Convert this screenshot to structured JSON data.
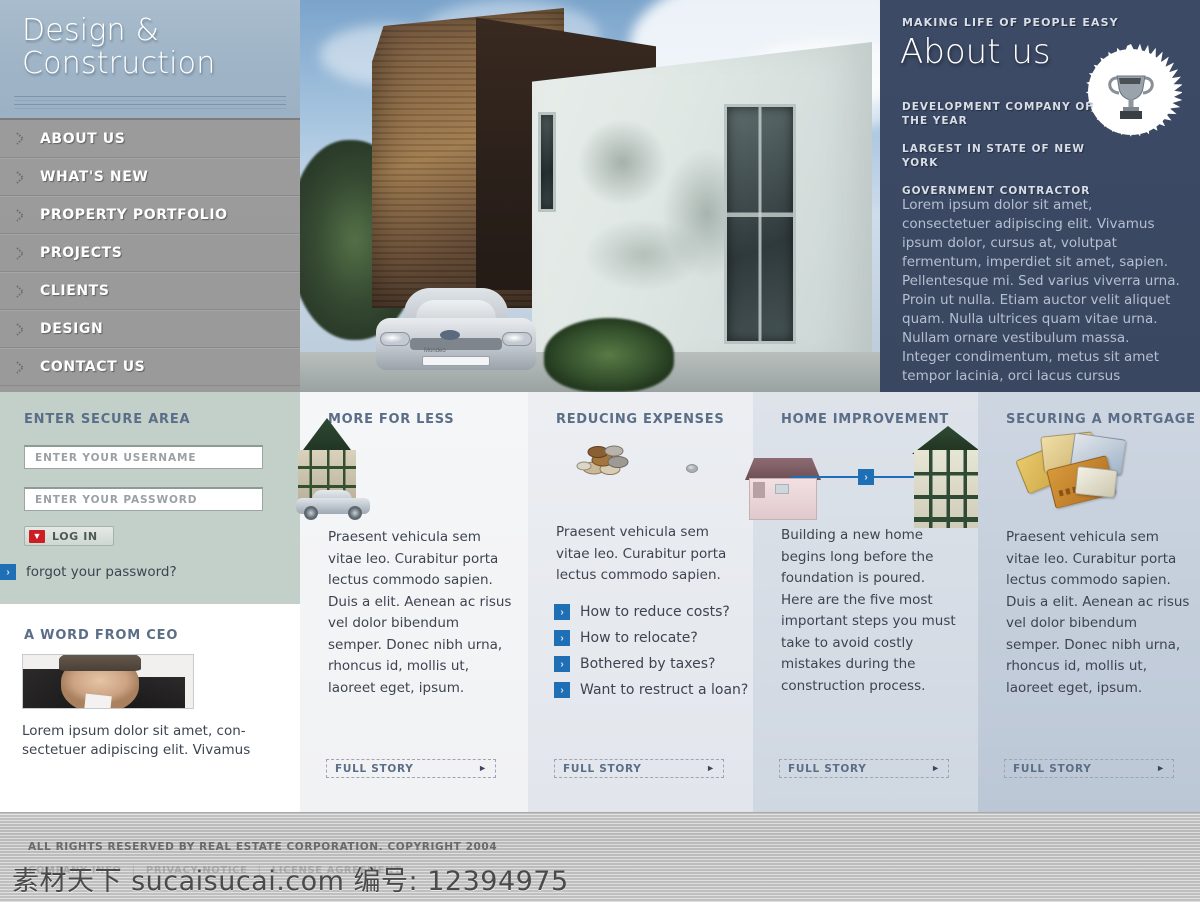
{
  "brand": {
    "line1": "Design &",
    "line2": "Construction"
  },
  "nav": {
    "items": [
      {
        "label": "ABOUT US"
      },
      {
        "label": "WHAT'S NEW"
      },
      {
        "label": "PROPERTY PORTFOLIO"
      },
      {
        "label": "PROJECTS"
      },
      {
        "label": "CLIENTS"
      },
      {
        "label": "DESIGN"
      },
      {
        "label": "CONTACT US"
      }
    ]
  },
  "about": {
    "kicker": "MAKING LIFE OF PEOPLE EASY",
    "title": "About us",
    "bullets": [
      "DEVELOPMENT COMPANY OF THE YEAR",
      "LARGEST IN STATE OF NEW YORK",
      "GOVERNMENT CONTRACTOR"
    ],
    "body": "Lorem ipsum dolor sit amet, consectetuer adipiscing elit. Vivamus ipsum dolor, cursus at, volutpat fermentum, imperdiet sit amet, sapien. Pellentesque mi. Sed varius viverra urna. Proin ut nulla. Etiam auctor velit aliquet quam. Nulla ultrices quam vitae urna. Nullam ornare vestibulum massa. Integer condimentum, metus sit amet tempor lacinia, orci lacus cursus",
    "badge_icon": "trophy-icon"
  },
  "login": {
    "title": "ENTER SECURE AREA",
    "username_placeholder": "ENTER YOUR USERNAME",
    "password_placeholder": "ENTER YOUR PASSWORD",
    "button_label": "LOG IN",
    "button_icon": "download-arrow-icon",
    "forgot_label": "forgot your password?"
  },
  "ceo": {
    "title": "A WORD FROM CEO",
    "photo_name": "ceo-portrait",
    "text": "Lorem ipsum dolor sit amet, con-sectetuer adipiscing elit. Vivamus"
  },
  "columns": [
    {
      "title": "MORE FOR LESS",
      "illustration": "house-and-car-icon",
      "body": "Praesent vehicula sem vitae leo. Curabitur porta lectus commodo sapien. Duis a elit. Aenean ac risus vel dolor bibendum semper. Donec nibh urna, rhoncus id, mollis ut, laoreet eget, ipsum.",
      "links": [],
      "full_story": "FULL STORY"
    },
    {
      "title": "REDUCING EXPENSES",
      "illustration": "coins-icon",
      "body": "Praesent vehicula sem vitae leo. Curabitur porta lectus commodo sapien.",
      "links": [
        "How to reduce costs?",
        "How to relocate?",
        "Bothered by taxes?",
        "Want to restruct a loan?"
      ],
      "full_story": "FULL STORY"
    },
    {
      "title": "HOME IMPROVEMENT",
      "illustration": "house-upgrade-icon",
      "body": "Building  a new home begins long before the foundation is poured. Here are the five  most important steps you must take to avoid costly mistakes during the  construction process.",
      "links": [],
      "full_story": "FULL STORY"
    },
    {
      "title": "SECURING A MORTGAGE",
      "illustration": "credit-cards-icon",
      "body": "Praesent vehicula sem vitae leo. Curabitur porta lectus commodo sapien. Duis a elit. Aenean ac risus vel dolor bibendum semper. Donec nibh urna, rhoncus id, mollis ut, laoreet eget, ipsum.",
      "links": [],
      "full_story": "FULL STORY"
    }
  ],
  "footer": {
    "copyright": "ALL RIGHTS RESERVED BY REAL ESTATE CORPORATION. COPYRIGHT 2004",
    "links": [
      "COMPANY INFO",
      "PRIVACY NOTICE",
      "LICENSE AGREEMENT"
    ],
    "separator": "|"
  },
  "watermark": {
    "text": "素材天下 sucaisucai.com  编号: 12394975"
  },
  "colors": {
    "accent_blue": "#1f6fb5",
    "heading_blue": "#5b6e88",
    "panel_navy": "#3c4a66",
    "logo_blue": "#a8bccd",
    "nav_grey": "#9b9b9b",
    "login_green": "#c3cfc9",
    "login_red": "#cc1f24"
  }
}
